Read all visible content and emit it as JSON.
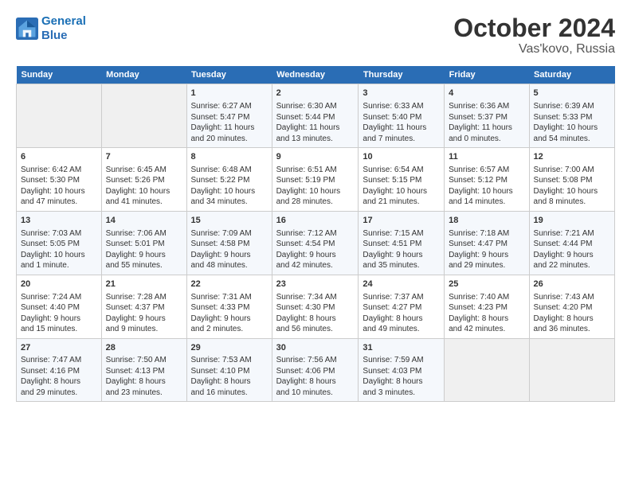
{
  "logo": {
    "line1": "General",
    "line2": "Blue"
  },
  "title": "October 2024",
  "subtitle": "Vas'kovo, Russia",
  "days_header": [
    "Sunday",
    "Monday",
    "Tuesday",
    "Wednesday",
    "Thursday",
    "Friday",
    "Saturday"
  ],
  "weeks": [
    [
      {
        "day": "",
        "data": ""
      },
      {
        "day": "",
        "data": ""
      },
      {
        "day": "1",
        "data": "Sunrise: 6:27 AM\nSunset: 5:47 PM\nDaylight: 11 hours\nand 20 minutes."
      },
      {
        "day": "2",
        "data": "Sunrise: 6:30 AM\nSunset: 5:44 PM\nDaylight: 11 hours\nand 13 minutes."
      },
      {
        "day": "3",
        "data": "Sunrise: 6:33 AM\nSunset: 5:40 PM\nDaylight: 11 hours\nand 7 minutes."
      },
      {
        "day": "4",
        "data": "Sunrise: 6:36 AM\nSunset: 5:37 PM\nDaylight: 11 hours\nand 0 minutes."
      },
      {
        "day": "5",
        "data": "Sunrise: 6:39 AM\nSunset: 5:33 PM\nDaylight: 10 hours\nand 54 minutes."
      }
    ],
    [
      {
        "day": "6",
        "data": "Sunrise: 6:42 AM\nSunset: 5:30 PM\nDaylight: 10 hours\nand 47 minutes."
      },
      {
        "day": "7",
        "data": "Sunrise: 6:45 AM\nSunset: 5:26 PM\nDaylight: 10 hours\nand 41 minutes."
      },
      {
        "day": "8",
        "data": "Sunrise: 6:48 AM\nSunset: 5:22 PM\nDaylight: 10 hours\nand 34 minutes."
      },
      {
        "day": "9",
        "data": "Sunrise: 6:51 AM\nSunset: 5:19 PM\nDaylight: 10 hours\nand 28 minutes."
      },
      {
        "day": "10",
        "data": "Sunrise: 6:54 AM\nSunset: 5:15 PM\nDaylight: 10 hours\nand 21 minutes."
      },
      {
        "day": "11",
        "data": "Sunrise: 6:57 AM\nSunset: 5:12 PM\nDaylight: 10 hours\nand 14 minutes."
      },
      {
        "day": "12",
        "data": "Sunrise: 7:00 AM\nSunset: 5:08 PM\nDaylight: 10 hours\nand 8 minutes."
      }
    ],
    [
      {
        "day": "13",
        "data": "Sunrise: 7:03 AM\nSunset: 5:05 PM\nDaylight: 10 hours\nand 1 minute."
      },
      {
        "day": "14",
        "data": "Sunrise: 7:06 AM\nSunset: 5:01 PM\nDaylight: 9 hours\nand 55 minutes."
      },
      {
        "day": "15",
        "data": "Sunrise: 7:09 AM\nSunset: 4:58 PM\nDaylight: 9 hours\nand 48 minutes."
      },
      {
        "day": "16",
        "data": "Sunrise: 7:12 AM\nSunset: 4:54 PM\nDaylight: 9 hours\nand 42 minutes."
      },
      {
        "day": "17",
        "data": "Sunrise: 7:15 AM\nSunset: 4:51 PM\nDaylight: 9 hours\nand 35 minutes."
      },
      {
        "day": "18",
        "data": "Sunrise: 7:18 AM\nSunset: 4:47 PM\nDaylight: 9 hours\nand 29 minutes."
      },
      {
        "day": "19",
        "data": "Sunrise: 7:21 AM\nSunset: 4:44 PM\nDaylight: 9 hours\nand 22 minutes."
      }
    ],
    [
      {
        "day": "20",
        "data": "Sunrise: 7:24 AM\nSunset: 4:40 PM\nDaylight: 9 hours\nand 15 minutes."
      },
      {
        "day": "21",
        "data": "Sunrise: 7:28 AM\nSunset: 4:37 PM\nDaylight: 9 hours\nand 9 minutes."
      },
      {
        "day": "22",
        "data": "Sunrise: 7:31 AM\nSunset: 4:33 PM\nDaylight: 9 hours\nand 2 minutes."
      },
      {
        "day": "23",
        "data": "Sunrise: 7:34 AM\nSunset: 4:30 PM\nDaylight: 8 hours\nand 56 minutes."
      },
      {
        "day": "24",
        "data": "Sunrise: 7:37 AM\nSunset: 4:27 PM\nDaylight: 8 hours\nand 49 minutes."
      },
      {
        "day": "25",
        "data": "Sunrise: 7:40 AM\nSunset: 4:23 PM\nDaylight: 8 hours\nand 42 minutes."
      },
      {
        "day": "26",
        "data": "Sunrise: 7:43 AM\nSunset: 4:20 PM\nDaylight: 8 hours\nand 36 minutes."
      }
    ],
    [
      {
        "day": "27",
        "data": "Sunrise: 7:47 AM\nSunset: 4:16 PM\nDaylight: 8 hours\nand 29 minutes."
      },
      {
        "day": "28",
        "data": "Sunrise: 7:50 AM\nSunset: 4:13 PM\nDaylight: 8 hours\nand 23 minutes."
      },
      {
        "day": "29",
        "data": "Sunrise: 7:53 AM\nSunset: 4:10 PM\nDaylight: 8 hours\nand 16 minutes."
      },
      {
        "day": "30",
        "data": "Sunrise: 7:56 AM\nSunset: 4:06 PM\nDaylight: 8 hours\nand 10 minutes."
      },
      {
        "day": "31",
        "data": "Sunrise: 7:59 AM\nSunset: 4:03 PM\nDaylight: 8 hours\nand 3 minutes."
      },
      {
        "day": "",
        "data": ""
      },
      {
        "day": "",
        "data": ""
      }
    ]
  ]
}
